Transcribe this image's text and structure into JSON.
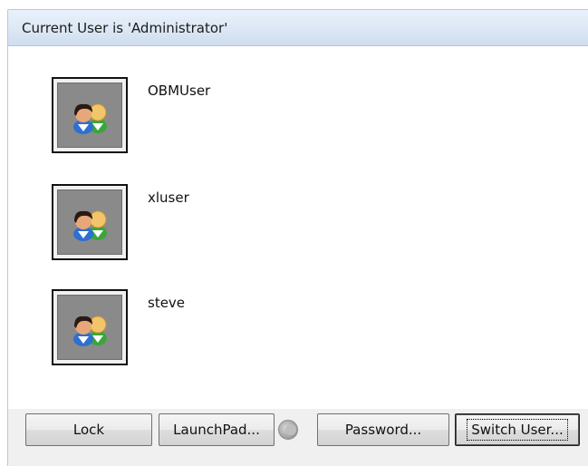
{
  "header": {
    "title": "Current User is 'Administrator'"
  },
  "users": [
    {
      "name": "OBMUser",
      "icon": "users-icon"
    },
    {
      "name": "xluser",
      "icon": "users-icon"
    },
    {
      "name": "steve",
      "icon": "users-icon"
    }
  ],
  "buttons": {
    "lock": "Lock",
    "launchpad": "LaunchPad...",
    "password": "Password...",
    "switch_user": "Switch User..."
  },
  "icons": {
    "launchpad_status": "moon-icon"
  },
  "colors": {
    "title_bar": "#dce8f5",
    "avatar_bg": "#8a8a8a",
    "bar_bg": "#f0f0f0"
  }
}
